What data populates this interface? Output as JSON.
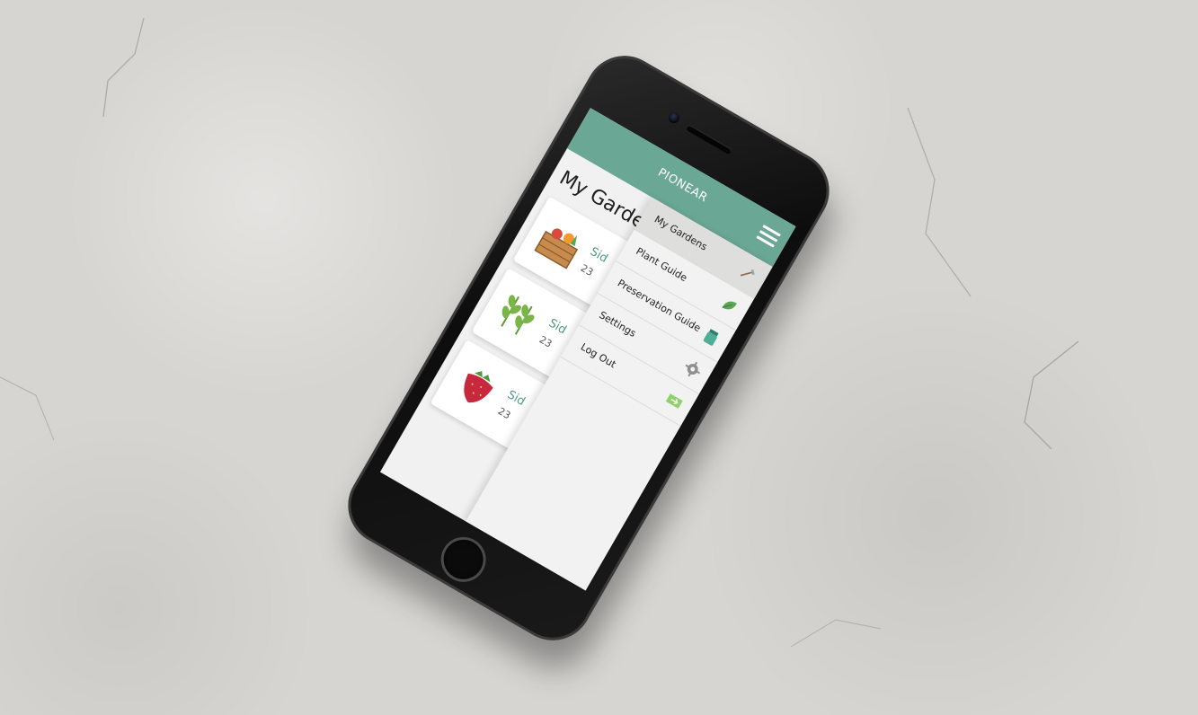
{
  "app": {
    "title": "PIONEAR"
  },
  "page": {
    "title": "My Garde"
  },
  "gardens": [
    {
      "name": "Sid",
      "meta": "23",
      "icon": "crate-icon"
    },
    {
      "name": "Sid",
      "meta": "23",
      "icon": "wheat-icon"
    },
    {
      "name": "Sid",
      "meta": "23",
      "icon": "strawberry-icon"
    }
  ],
  "menu": {
    "items": [
      {
        "label": "My Gardens",
        "icon": "shovel-icon",
        "active": true
      },
      {
        "label": "Plant Guide",
        "icon": "leaf-icon",
        "active": false
      },
      {
        "label": "Preservation Guide",
        "icon": "jar-icon",
        "active": false
      },
      {
        "label": "Settings",
        "icon": "gear-icon",
        "active": false
      },
      {
        "label": "Log Out",
        "icon": "exit-icon",
        "active": false
      }
    ]
  },
  "colors": {
    "accent": "#6aa895",
    "garden_name": "#4f9b81"
  }
}
